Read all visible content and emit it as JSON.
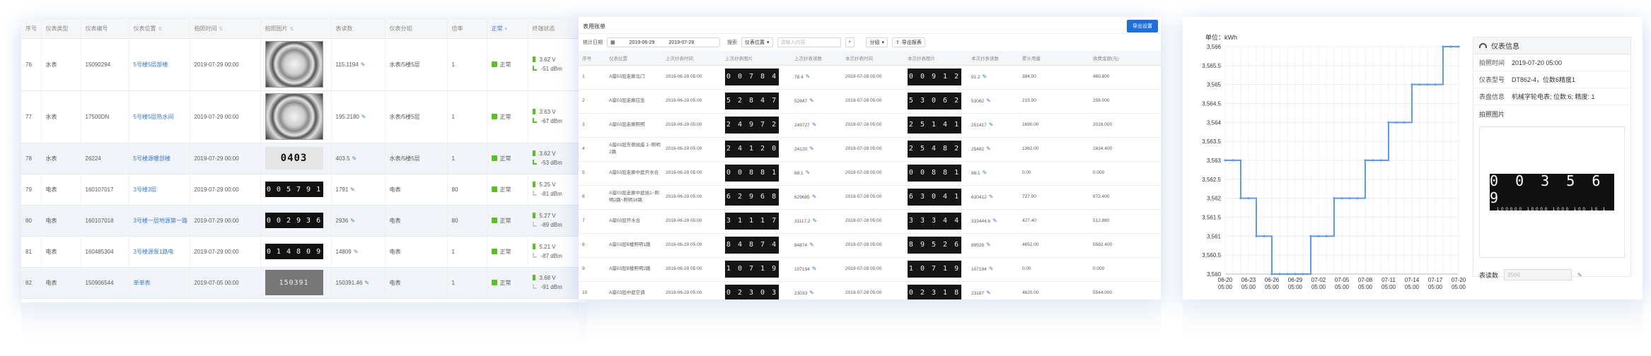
{
  "p1": {
    "headers": [
      "序号",
      "仪表类型",
      "仪表编号",
      "仪表位置",
      "拍照时间",
      "拍照图片",
      "表读数",
      "仪表分组",
      "倍率",
      "状态",
      "终端状态"
    ],
    "status_filter": "正常",
    "rows": [
      {
        "no": "76",
        "type": "水表",
        "id": "15090294",
        "loc": "5号楼5层部楼",
        "time": "2019-07-29 00:00",
        "read": "115.1194",
        "group": "水表/5楼5层",
        "rate": "1",
        "status": "正常",
        "volt": "3.62 V",
        "rssi": "-51 dBm",
        "img": "dial"
      },
      {
        "no": "77",
        "type": "水表",
        "id": "17500DN",
        "loc": "5号楼5层热水间",
        "time": "2019-07-29 00:00",
        "read": "195.2180",
        "group": "水表/5楼5层",
        "rate": "1",
        "status": "正常",
        "volt": "3.63 V",
        "rssi": "-67 dBm",
        "img": "dial"
      },
      {
        "no": "78",
        "type": "水表",
        "id": "26224",
        "loc": "5号楼源暖部楼",
        "time": "2019-07-29 00:00",
        "read": "403.5",
        "group": "水表/5楼5层",
        "rate": "1",
        "status": "正常",
        "volt": "3.62 V",
        "rssi": "-53 dBm",
        "img": "light",
        "digits": "0403"
      },
      {
        "no": "79",
        "type": "电表",
        "id": "160107017",
        "loc": "3号楼3层",
        "time": "2019-07-29 00:00",
        "read": "1791",
        "group": "电表",
        "rate": "80",
        "status": "正常",
        "volt": "5.25 V",
        "rssi": "-81 dBm",
        "img": "strip",
        "digits": "0 0 5 7 9 1"
      },
      {
        "no": "80",
        "type": "电表",
        "id": "160107018",
        "loc": "3号楼一层地源第一路",
        "time": "2019-07-29 00:00",
        "read": "2936",
        "group": "电表",
        "rate": "80",
        "status": "正常",
        "volt": "5.27 V",
        "rssi": "-89 dBm",
        "img": "strip",
        "digits": "0 0 2 9 3 6"
      },
      {
        "no": "81",
        "type": "电表",
        "id": "160485304",
        "loc": "3号楼源泵1路电",
        "time": "2019-07-29 00:00",
        "read": "14809",
        "group": "电表",
        "rate": "1",
        "status": "正常",
        "volt": "5.21 V",
        "rssi": "-87 dBm",
        "img": "strip",
        "digits": "0 1 4 8 0 9"
      },
      {
        "no": "82",
        "type": "电表",
        "id": "150906544",
        "loc": "单单表",
        "time": "2019-07-05 00:00",
        "read": "150391.46",
        "group": "电表",
        "rate": "1",
        "status": "正常",
        "volt": "3.68 V",
        "rssi": "-91 dBm",
        "img": "tall",
        "digits": "150391"
      }
    ]
  },
  "p2": {
    "title": "表用账单",
    "button": "导出设置",
    "filter": {
      "label_date": "统计日期",
      "date_from": "2019-06-29",
      "date_to": "2019-07-28",
      "label_search": "搜索",
      "sel": "仪表位置",
      "placeholder": "请输入内容",
      "group": "分组",
      "export": "导出报表"
    },
    "headers": [
      "序号",
      "仪表位置",
      "上次抄表时间",
      "上次抄表图片",
      "上次抄表读数",
      "本次抄表时间",
      "本次抄表图片",
      "本次抄表读数",
      "累计用量",
      "收费金额(元)"
    ],
    "rows": [
      {
        "no": "1",
        "loc": "A座03层走廊北门",
        "t1": "2019-06-29 05:00",
        "d1": "0 0 7 8 4",
        "r1": "78.4",
        "t2": "2019-07-28 05:00",
        "d2": "0 0 9 1 2",
        "r2": "91.2",
        "use": "384.00",
        "fee": "460.800"
      },
      {
        "no": "2",
        "loc": "A座03层走廊应急",
        "t1": "2019-06-29 05:00",
        "d1": "5 2 8 4 7",
        "r1": "52847",
        "t2": "2019-07-28 05:00",
        "d2": "5 3 0 6 2",
        "r2": "53062",
        "use": "215.00",
        "fee": "258.000"
      },
      {
        "no": "3",
        "loc": "A座03层走廊照明",
        "t1": "2019-06-29 05:00",
        "d1": "2 4 9 7 2",
        "r1": "249727",
        "t2": "2019-07-28 05:00",
        "d2": "2 5 1 4 1",
        "r2": "251417",
        "use": "1690.00",
        "fee": "2028.000"
      },
      {
        "no": "4",
        "loc": "A座03层东侧插座 1~照明2路",
        "t1": "2019-06-29 05:00",
        "d1": "2 4 1 2 0",
        "r1": "24120",
        "t2": "2019-07-28 05:00",
        "d2": "2 5 4 8 2",
        "r2": "25482",
        "use": "1362.00",
        "fee": "1634.400"
      },
      {
        "no": "5",
        "loc": "A座03层走廊中庭开水合",
        "t1": "2019-06-29 05:00",
        "d1": "0 0 8 8 1",
        "r1": "88.1",
        "t2": "2019-07-28 05:00",
        "d2": "0 0 8 8 1",
        "r2": "88.1",
        "use": "0.00",
        "fee": "0.000"
      },
      {
        "no": "6",
        "loc": "A座03层走廊中庭插1~照明2路~照明18路",
        "t1": "2019-06-29 05:00",
        "d1": "6 2 9 6 8",
        "r1": "629685",
        "t2": "2019-07-28 05:00",
        "d2": "6 3 0 4 1",
        "r2": "630412",
        "use": "727.00",
        "fee": "872.400"
      },
      {
        "no": "7",
        "loc": "A座03层开水合",
        "t1": "2019-06-29 05:00",
        "d1": "3 1 1 1 7",
        "r1": "31117.2",
        "t2": "2019-07-28 05:00",
        "d2": "3 3 3 4 4",
        "r2": "333444.6",
        "use": "427.40",
        "fee": "512.880"
      },
      {
        "no": "8",
        "loc": "A座03层B楼照明1路",
        "t1": "2019-06-29 05:00",
        "d1": "8 4 8 7 4",
        "r1": "84874",
        "t2": "2019-07-28 05:00",
        "d2": "8 9 5 2 6",
        "r2": "89526",
        "use": "4652.00",
        "fee": "5582.400"
      },
      {
        "no": "9",
        "loc": "A座03层B楼照明2路",
        "t1": "2019-06-29 05:00",
        "d1": "1 0 7 1 9",
        "r1": "107194",
        "t2": "2019-07-28 05:00",
        "d2": "1 0 7 1 9",
        "r2": "107194",
        "use": "0.00",
        "fee": "0.000"
      },
      {
        "no": "10",
        "loc": "A座03层中庭空调",
        "t1": "2019-06-29 05:00",
        "d1": "0 2 3 0 3",
        "r1": "23033",
        "t2": "2019-07-28 05:00",
        "d2": "0 2 3 1 8",
        "r2": "23187",
        "use": "4620.00",
        "fee": "5544.000"
      }
    ]
  },
  "p3": {
    "unit": "单位：kWh",
    "info": {
      "title": "仪表信息",
      "time_k": "拍照时间",
      "time_v": "2019-07-20 05:00",
      "model_k": "仪表型号",
      "model_v": "DT862-4，位数6精度1",
      "meter_k": "表盘信息",
      "meter_v": "机械字轮电表; 位数:6; 精度: 1",
      "photo_k": "拍照图片",
      "photo_digits": "0 0 3 5 6 9",
      "photo_scale": "100000 10000 1000 100 10 1",
      "read_k": "表读数",
      "read_v": "3566"
    },
    "colors": {
      "line": "#5b9bf0"
    },
    "chart_data": {
      "type": "line",
      "ylabel": "单位：kWh",
      "ylim": [
        3560,
        3566
      ],
      "yticks": [
        "3,560",
        "3,560.5",
        "3,561",
        "3,561.5",
        "3,562",
        "3,562.5",
        "3,563",
        "3,563.5",
        "3,564",
        "3,564.5",
        "3,565",
        "3,565.5",
        "3,566"
      ],
      "x": [
        "06-20",
        "06-21",
        "06-22",
        "06-23",
        "06-24",
        "06-25",
        "06-26",
        "06-27",
        "06-28",
        "06-29",
        "06-30",
        "07-01",
        "07-02",
        "07-03",
        "07-04",
        "07-05",
        "07-06",
        "07-07",
        "07-08",
        "07-09",
        "07-10",
        "07-11",
        "07-12",
        "07-13",
        "07-14",
        "07-15",
        "07-16",
        "07-17",
        "07-18",
        "07-19",
        "07-20"
      ],
      "xtick_labels": [
        [
          "06-20",
          "05:00"
        ],
        [
          "06-23",
          "05:00"
        ],
        [
          "06-26",
          "05:00"
        ],
        [
          "06-29",
          "05:00"
        ],
        [
          "07-02",
          "05:00"
        ],
        [
          "07-05",
          "05:00"
        ],
        [
          "07-08",
          "05:00"
        ],
        [
          "07-11",
          "05:00"
        ],
        [
          "07-14",
          "05:00"
        ],
        [
          "07-17",
          "05:00"
        ],
        [
          "07-20",
          "05:00"
        ]
      ],
      "values": [
        3563,
        3563,
        3562,
        3562,
        3561,
        3561,
        3560,
        3560,
        3560,
        3560,
        3560,
        3561,
        3561,
        3561,
        3562,
        3562,
        3562,
        3562,
        3563,
        3563,
        3563,
        3564,
        3564,
        3564,
        3565,
        3565,
        3565,
        3565,
        3566,
        3566,
        3566
      ],
      "grid": true
    }
  }
}
